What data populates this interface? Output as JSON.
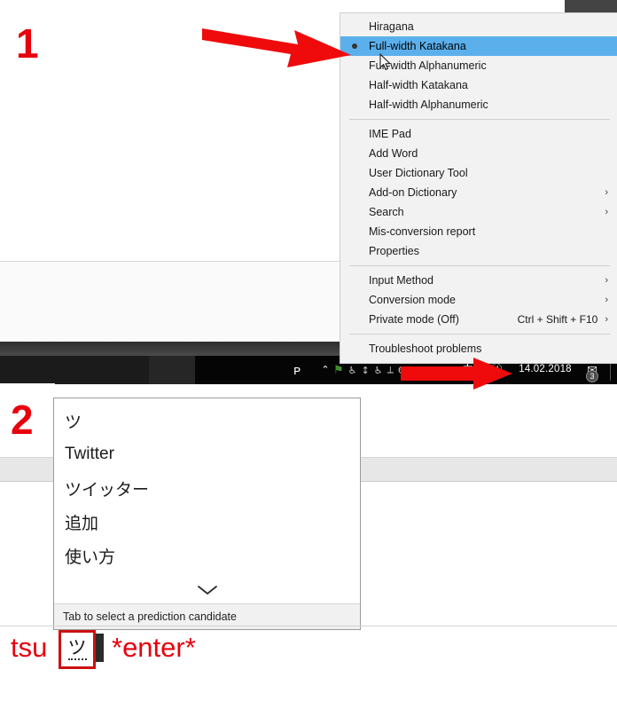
{
  "annotations": {
    "step1_label": "1",
    "step2_label": "2",
    "arrow_color": "#e8000d",
    "number_color": "#e8000d"
  },
  "ime_menu": {
    "input_modes": [
      {
        "label": "Hiragana",
        "selected": false,
        "submenu": false,
        "accelerator": ""
      },
      {
        "label": "Full-width Katakana",
        "selected": true,
        "submenu": false,
        "accelerator": ""
      },
      {
        "label": "Full-width Alphanumeric",
        "selected": false,
        "submenu": false,
        "accelerator": ""
      },
      {
        "label": "Half-width Katakana",
        "selected": false,
        "submenu": false,
        "accelerator": ""
      },
      {
        "label": "Half-width Alphanumeric",
        "selected": false,
        "submenu": false,
        "accelerator": ""
      }
    ],
    "tools": [
      {
        "label": "IME Pad",
        "submenu": false,
        "accelerator": ""
      },
      {
        "label": "Add Word",
        "submenu": false,
        "accelerator": ""
      },
      {
        "label": "User Dictionary Tool",
        "submenu": false,
        "accelerator": ""
      },
      {
        "label": "Add-on Dictionary",
        "submenu": true,
        "accelerator": ""
      },
      {
        "label": "Search",
        "submenu": true,
        "accelerator": ""
      },
      {
        "label": "Mis-conversion report",
        "submenu": false,
        "accelerator": ""
      },
      {
        "label": "Properties",
        "submenu": false,
        "accelerator": ""
      }
    ],
    "settings": [
      {
        "label": "Input Method",
        "submenu": true,
        "accelerator": ""
      },
      {
        "label": "Conversion mode",
        "submenu": true,
        "accelerator": ""
      },
      {
        "label": "Private mode (Off)",
        "submenu": true,
        "accelerator": "Ctrl + Shift + F10"
      }
    ],
    "footer": [
      {
        "label": "Troubleshoot problems",
        "submenu": false,
        "accelerator": ""
      }
    ],
    "submenu_chevron": "›",
    "highlight_color": "#5bb0ec",
    "radio_marker": "selected-radio-dot"
  },
  "taskbar": {
    "background": "#000000",
    "tray": {
      "people_icon": "ᴘ",
      "overflow_chevron": "⌃",
      "misc_glyphs": [
        "⚑",
        "⎇",
        "⇅",
        "⎇",
        "⟂",
        "ΓΙӏΙ"
      ],
      "ime_mode_indicator": "カ",
      "ime_tool_indicator": "Ⓙ",
      "clock": "14.02.2018",
      "action_center_icon": "✉",
      "notification_badge": "3"
    }
  },
  "candidate_window": {
    "candidates": [
      {
        "text": "ツ",
        "script": "katakana"
      },
      {
        "text": "Twitter",
        "script": "latin"
      },
      {
        "text": "ツイッター",
        "script": "katakana"
      },
      {
        "text": "追加",
        "script": "kanji"
      },
      {
        "text": "使い方",
        "script": "kanji"
      }
    ],
    "expander_icon": "⌄",
    "footer_hint": "Tab to select a prediction candidate"
  },
  "typing_line": {
    "romaji_input": "tsu",
    "composition_char": "ツ",
    "enter_label": "*enter*",
    "composition_box_color": "#cc1111"
  }
}
